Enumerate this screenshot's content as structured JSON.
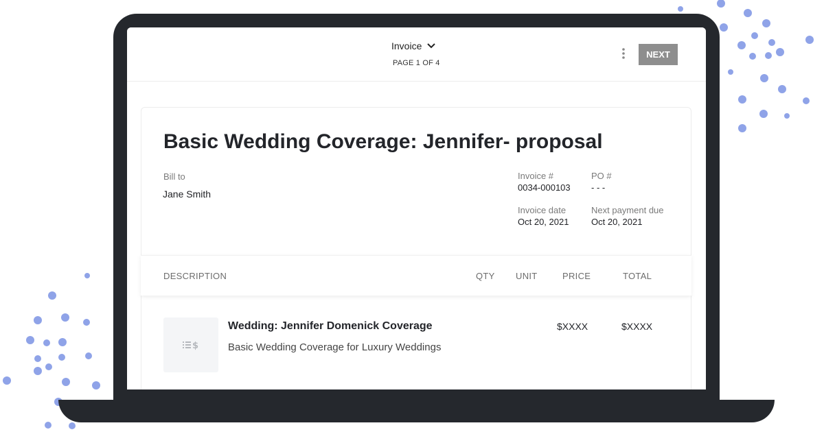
{
  "colors": {
    "dots": "#8fa3e8",
    "laptop": "#25282d",
    "next_button": "#8e8e8e"
  },
  "toolbar": {
    "document_type": "Invoice",
    "dropdown_icon": "chevron-down-icon",
    "page_indicator": "PAGE 1 OF 4",
    "menu_icon": "kebab-menu-icon",
    "next_label": "NEXT"
  },
  "invoice": {
    "title": "Basic Wedding Coverage: Jennifer- proposal",
    "bill_to_label": "Bill to",
    "bill_to_value": "Jane Smith",
    "invoice_number_label": "Invoice #",
    "invoice_number_value": "0034-000103",
    "po_label": "PO #",
    "po_value": "- - -",
    "invoice_date_label": "Invoice date",
    "invoice_date_value": "Oct 20, 2021",
    "next_payment_label": "Next payment due",
    "next_payment_value": "Oct 20, 2021"
  },
  "table": {
    "headers": [
      "DESCRIPTION",
      "QTY",
      "UNIT",
      "PRICE",
      "TOTAL"
    ],
    "items": [
      {
        "icon": "price-list-icon",
        "title": "Wedding: Jennifer Domenick Coverage",
        "description": "Basic Wedding Coverage for Luxury Weddings",
        "price": "$XXXX",
        "total": "$XXXX"
      }
    ]
  }
}
